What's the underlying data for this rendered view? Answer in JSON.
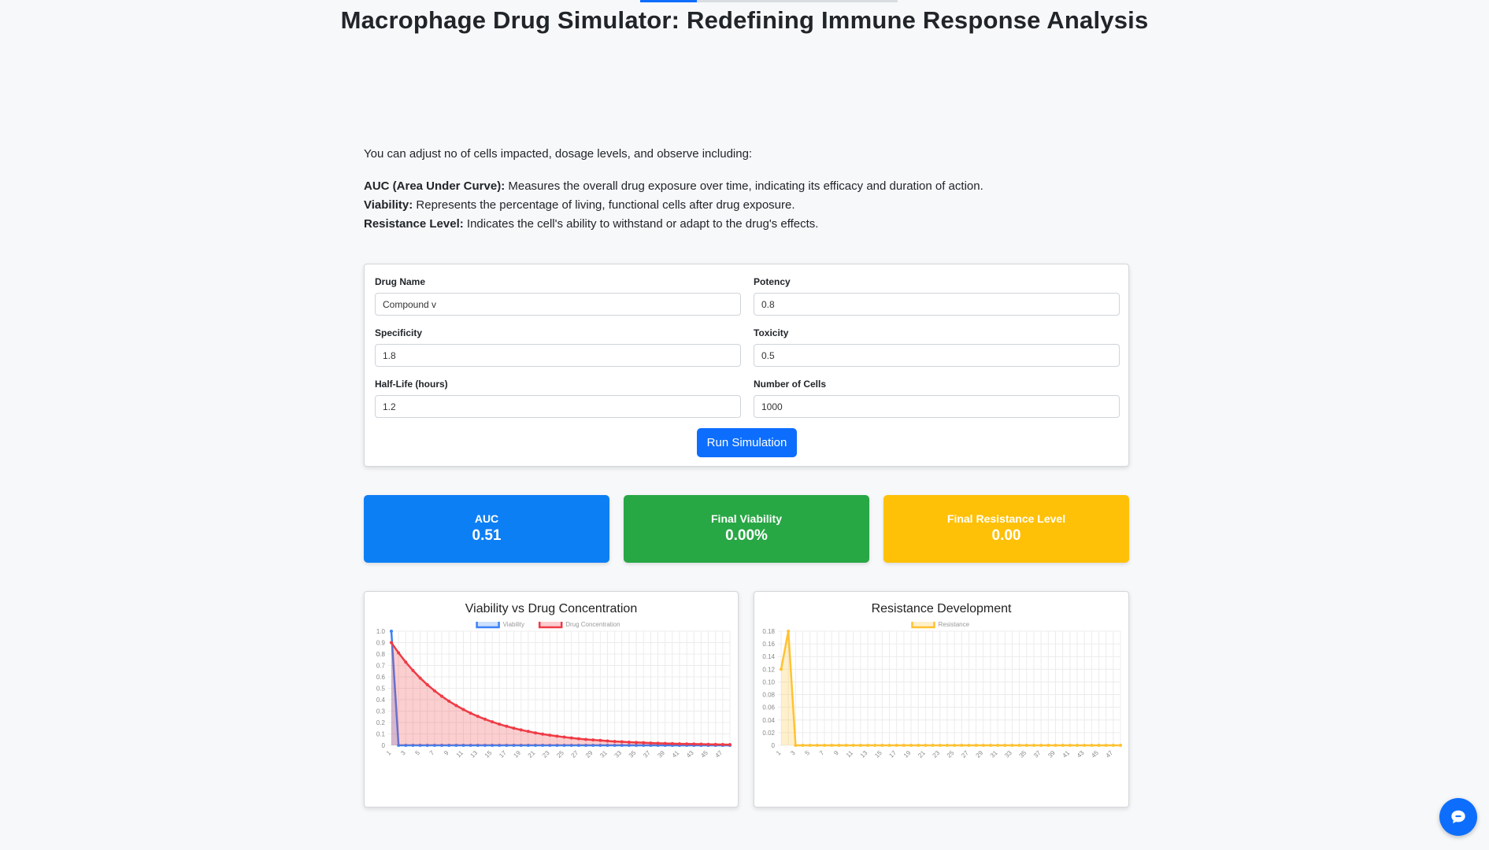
{
  "page": {
    "title": "Macrophage Drug Simulator: Redefining Immune Response Analysis",
    "progress": 0.22
  },
  "intro": {
    "lead": "You can adjust no of cells impacted, dosage levels, and observe including:",
    "definitions": [
      {
        "term": "AUC (Area Under Curve):",
        "text": " Measures the overall drug exposure over time, indicating its efficacy and duration of action."
      },
      {
        "term": "Viability:",
        "text": " Represents the percentage of living, functional cells after drug exposure."
      },
      {
        "term": "Resistance Level:",
        "text": " Indicates the cell's ability to withstand or adapt to the drug's effects."
      }
    ]
  },
  "form": {
    "fields": [
      {
        "label": "Drug Name",
        "value": "Compound v"
      },
      {
        "label": "Potency",
        "value": "0.8"
      },
      {
        "label": "Specificity",
        "value": "1.8"
      },
      {
        "label": "Toxicity",
        "value": "0.5"
      },
      {
        "label": "Half-Life (hours)",
        "value": "1.2"
      },
      {
        "label": "Number of Cells",
        "value": "1000"
      }
    ],
    "run_label": "Run Simulation"
  },
  "stats": [
    {
      "label": "AUC",
      "value": "0.51",
      "color": "#0d7ff5"
    },
    {
      "label": "Final Viability",
      "value": "0.00%",
      "color": "#28a745"
    },
    {
      "label": "Final Resistance Level",
      "value": "0.00",
      "color": "#ffc107"
    }
  ],
  "chart_data": [
    {
      "type": "line",
      "title": "Viability vs Drug Concentration",
      "x": [
        1,
        2,
        3,
        4,
        5,
        6,
        7,
        8,
        9,
        10,
        11,
        12,
        13,
        14,
        15,
        16,
        17,
        18,
        19,
        20,
        21,
        22,
        23,
        24,
        25,
        26,
        27,
        28,
        29,
        30,
        31,
        32,
        33,
        34,
        35,
        36,
        37,
        38,
        39,
        40,
        41,
        42,
        43,
        44,
        45,
        46,
        47,
        48
      ],
      "x_tick_labels": [
        "1",
        "3",
        "5",
        "7",
        "9",
        "11",
        "13",
        "15",
        "17",
        "19",
        "21",
        "23",
        "25",
        "27",
        "29",
        "31",
        "33",
        "35",
        "37",
        "39",
        "41",
        "43",
        "45",
        "47"
      ],
      "ylim": [
        0,
        1.0
      ],
      "y_ticks": [
        "0",
        "0.1",
        "0.2",
        "0.3",
        "0.4",
        "0.5",
        "0.6",
        "0.7",
        "0.8",
        "0.9",
        "1.0"
      ],
      "legend_position": "top",
      "grid": true,
      "series": [
        {
          "name": "Viability",
          "color": "#3b82f6",
          "fill": "rgba(59,130,246,0.25)",
          "values": [
            1.0,
            0,
            0,
            0,
            0,
            0,
            0,
            0,
            0,
            0,
            0,
            0,
            0,
            0,
            0,
            0,
            0,
            0,
            0,
            0,
            0,
            0,
            0,
            0,
            0,
            0,
            0,
            0,
            0,
            0,
            0,
            0,
            0,
            0,
            0,
            0,
            0,
            0,
            0,
            0,
            0,
            0,
            0,
            0,
            0,
            0,
            0,
            0
          ]
        },
        {
          "name": "Drug Concentration",
          "color": "#ef3b45",
          "fill": "rgba(239,59,69,0.25)",
          "decay": 0.9,
          "values": [
            0.9,
            0.81,
            0.729,
            0.656,
            0.59,
            0.531,
            0.478,
            0.43,
            0.387,
            0.349,
            0.314,
            0.282,
            0.254,
            0.229,
            0.206,
            0.185,
            0.167,
            0.15,
            0.135,
            0.122,
            0.109,
            0.098,
            0.089,
            0.08,
            0.072,
            0.065,
            0.058,
            0.052,
            0.047,
            0.043,
            0.038,
            0.034,
            0.031,
            0.028,
            0.025,
            0.023,
            0.02,
            0.018,
            0.016,
            0.015,
            0.013,
            0.012,
            0.011,
            0.01,
            0.009,
            0.008,
            0.007,
            0.006
          ]
        }
      ]
    },
    {
      "type": "line",
      "title": "Resistance Development",
      "x": [
        1,
        2,
        3,
        4,
        5,
        6,
        7,
        8,
        9,
        10,
        11,
        12,
        13,
        14,
        15,
        16,
        17,
        18,
        19,
        20,
        21,
        22,
        23,
        24,
        25,
        26,
        27,
        28,
        29,
        30,
        31,
        32,
        33,
        34,
        35,
        36,
        37,
        38,
        39,
        40,
        41,
        42,
        43,
        44,
        45,
        46,
        47,
        48
      ],
      "x_tick_labels": [
        "1",
        "3",
        "5",
        "7",
        "9",
        "11",
        "13",
        "15",
        "17",
        "19",
        "21",
        "23",
        "25",
        "27",
        "29",
        "31",
        "33",
        "35",
        "37",
        "39",
        "41",
        "43",
        "45",
        "47"
      ],
      "ylim": [
        0,
        0.18
      ],
      "y_ticks": [
        "0",
        "0.02",
        "0.04",
        "0.06",
        "0.08",
        "0.10",
        "0.12",
        "0.14",
        "0.16",
        "0.18"
      ],
      "legend_position": "top",
      "grid": true,
      "series": [
        {
          "name": "Resistance",
          "color": "#ffc233",
          "fill": "rgba(255,194,51,0.25)",
          "values": [
            0.12,
            0.18,
            0,
            0,
            0,
            0,
            0,
            0,
            0,
            0,
            0,
            0,
            0,
            0,
            0,
            0,
            0,
            0,
            0,
            0,
            0,
            0,
            0,
            0,
            0,
            0,
            0,
            0,
            0,
            0,
            0,
            0,
            0,
            0,
            0,
            0,
            0,
            0,
            0,
            0,
            0,
            0,
            0,
            0,
            0,
            0,
            0,
            0
          ]
        }
      ]
    }
  ]
}
